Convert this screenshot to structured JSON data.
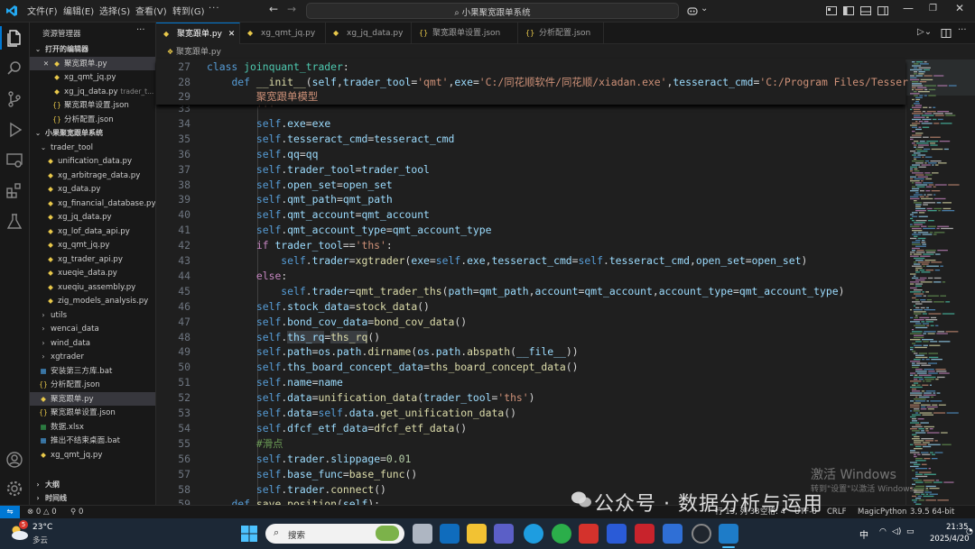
{
  "titlebar": {
    "menus": [
      "文件(F)",
      "编辑(E)",
      "选择(S)",
      "查看(V)",
      "转到(G)"
    ],
    "search_text": "小果聚宽跟单系统"
  },
  "sidebar": {
    "title": "资源管理器",
    "open_editors_header": "打开的编辑器",
    "open_editors": [
      {
        "label": "聚宽跟单.py",
        "type": "py",
        "selected": true
      },
      {
        "label": "xg_qmt_jq.py",
        "type": "py"
      },
      {
        "label": "xg_jq_data.py",
        "extra": "trader_t...",
        "type": "py"
      },
      {
        "label": "聚宽跟单设置.json",
        "type": "json"
      },
      {
        "label": "分析配置.json",
        "type": "json"
      }
    ],
    "project_header": "小果聚宽跟单系统",
    "tree": [
      {
        "label": "trader_tool",
        "type": "folder-open",
        "indent": 1
      },
      {
        "label": "unification_data.py",
        "type": "py",
        "indent": 2
      },
      {
        "label": "xg_arbitrage_data.py",
        "type": "py",
        "indent": 2
      },
      {
        "label": "xg_data.py",
        "type": "py",
        "indent": 2
      },
      {
        "label": "xg_financial_database.py",
        "type": "py",
        "indent": 2
      },
      {
        "label": "xg_jq_data.py",
        "type": "py",
        "indent": 2
      },
      {
        "label": "xg_lof_data_api.py",
        "type": "py",
        "indent": 2
      },
      {
        "label": "xg_qmt_jq.py",
        "type": "py",
        "indent": 2
      },
      {
        "label": "xg_trader_api.py",
        "type": "py",
        "indent": 2
      },
      {
        "label": "xueqie_data.py",
        "type": "py",
        "indent": 2
      },
      {
        "label": "xueqiu_assembly.py",
        "type": "py",
        "indent": 2
      },
      {
        "label": "zig_models_analysis.py",
        "type": "py",
        "indent": 2
      },
      {
        "label": "utils",
        "type": "folder",
        "indent": 1
      },
      {
        "label": "wencai_data",
        "type": "folder",
        "indent": 1
      },
      {
        "label": "wind_data",
        "type": "folder",
        "indent": 1
      },
      {
        "label": "xgtrader",
        "type": "folder",
        "indent": 1
      },
      {
        "label": "安装第三方库.bat",
        "type": "bat",
        "indent": 1
      },
      {
        "label": "分析配置.json",
        "type": "json",
        "indent": 1
      },
      {
        "label": "聚宽跟单.py",
        "type": "py",
        "indent": 1,
        "selected": true
      },
      {
        "label": "聚宽跟单设置.json",
        "type": "json",
        "indent": 1
      },
      {
        "label": "数据.xlsx",
        "type": "xlsx",
        "indent": 1
      },
      {
        "label": "推出不结束桌面.bat",
        "type": "bat",
        "indent": 1
      },
      {
        "label": "xg_qmt_jq.py",
        "type": "py",
        "indent": 1
      }
    ],
    "outline_header": "大纲",
    "timeline_header": "时间线"
  },
  "tabs": [
    {
      "label": "聚宽跟单.py",
      "type": "py",
      "active": true
    },
    {
      "label": "xg_qmt_jq.py",
      "type": "py"
    },
    {
      "label": "xg_jq_data.py",
      "type": "py"
    },
    {
      "label": "聚宽跟单设置.json",
      "type": "json"
    },
    {
      "label": "分析配置.json",
      "type": "json"
    }
  ],
  "breadcrumb": "聚宽跟单.py",
  "sticky": [
    {
      "n": "27",
      "html": "<span class=\"kw\">class</span> <span class=\"cls\">joinquant_trader</span>:"
    },
    {
      "n": "28",
      "html": "    <span class=\"kw\">def</span> <span class=\"fn\">__init__</span>(<span class=\"pm\">self</span>,<span class=\"pm\">trader_tool</span>=<span class=\"st\">'qmt'</span>,<span class=\"pm\">exe</span>=<span class=\"st\">'C:/同花顺软件/同花顺/xiadan.exe'</span>,<span class=\"pm\">tesseract_cmd</span>=<span class=\"st\">'C:/Program Files/Tesser</span>"
    },
    {
      "n": "29",
      "html": "        <span class=\"st\">聚宽跟单模型</span>"
    }
  ],
  "code": [
    {
      "n": "33",
      "html": "        <span class=\"st\">'''</span>"
    },
    {
      "n": "34",
      "html": "        <span class=\"sf\">self</span>.<span class=\"pm\">exe</span>=<span class=\"pm\">exe</span>"
    },
    {
      "n": "35",
      "html": "        <span class=\"sf\">self</span>.<span class=\"pm\">tesseract_cmd</span>=<span class=\"pm\">tesseract_cmd</span>"
    },
    {
      "n": "36",
      "html": "        <span class=\"sf\">self</span>.<span class=\"pm\">qq</span>=<span class=\"pm\">qq</span>"
    },
    {
      "n": "37",
      "html": "        <span class=\"sf\">self</span>.<span class=\"pm\">trader_tool</span>=<span class=\"pm\">trader_tool</span>"
    },
    {
      "n": "38",
      "html": "        <span class=\"sf\">self</span>.<span class=\"pm\">open_set</span>=<span class=\"pm\">open_set</span>"
    },
    {
      "n": "39",
      "html": "        <span class=\"sf\">self</span>.<span class=\"pm\">qmt_path</span>=<span class=\"pm\">qmt_path</span>"
    },
    {
      "n": "40",
      "html": "        <span class=\"sf\">self</span>.<span class=\"pm\">qmt_account</span>=<span class=\"pm\">qmt_account</span>"
    },
    {
      "n": "41",
      "html": "        <span class=\"sf\">self</span>.<span class=\"pm\">qmt_account_type</span>=<span class=\"pm\">qmt_account_type</span>"
    },
    {
      "n": "42",
      "html": "        <span class=\"ctl\">if</span> <span class=\"pm\">trader_tool</span>==<span class=\"st\">'ths'</span>:"
    },
    {
      "n": "43",
      "html": "            <span class=\"sf\">self</span>.<span class=\"pm\">trader</span>=<span class=\"fn\">xgtrader</span>(<span class=\"pm\">exe</span>=<span class=\"sf\">self</span>.<span class=\"pm\">exe</span>,<span class=\"pm\">tesseract_cmd</span>=<span class=\"sf\">self</span>.<span class=\"pm\">tesseract_cmd</span>,<span class=\"pm\">open_set</span>=<span class=\"pm\">open_set</span>)"
    },
    {
      "n": "44",
      "html": "        <span class=\"ctl\">else</span>:"
    },
    {
      "n": "45",
      "html": "            <span class=\"sf\">self</span>.<span class=\"pm\">trader</span>=<span class=\"fn\">qmt_trader_ths</span>(<span class=\"pm\">path</span>=<span class=\"pm\">qmt_path</span>,<span class=\"pm\">account</span>=<span class=\"pm\">qmt_account</span>,<span class=\"pm\">account_type</span>=<span class=\"pm\">qmt_account_type</span>)"
    },
    {
      "n": "46",
      "html": "        <span class=\"sf\">self</span>.<span class=\"pm\">stock_data</span>=<span class=\"fn\">stock_data</span>()"
    },
    {
      "n": "47",
      "html": "        <span class=\"sf\">self</span>.<span class=\"pm\">bond_cov_data</span>=<span class=\"fn\">bond_cov_data</span>()"
    },
    {
      "n": "48",
      "html": "        <span class=\"sf\">self</span>.<span class=\"pm hl\">ths_rq</span>=<span class=\"fn hl\">ths_rq</span>()"
    },
    {
      "n": "49",
      "html": "        <span class=\"sf\">self</span>.<span class=\"pm\">path</span>=<span class=\"pm\">os</span>.<span class=\"pm\">path</span>.<span class=\"fn\">dirname</span>(<span class=\"pm\">os</span>.<span class=\"pm\">path</span>.<span class=\"fn\">abspath</span>(<span class=\"pm\">__file__</span>))"
    },
    {
      "n": "50",
      "html": "        <span class=\"sf\">self</span>.<span class=\"pm\">ths_board_concept_data</span>=<span class=\"fn\">ths_board_concept_data</span>()"
    },
    {
      "n": "51",
      "html": "        <span class=\"sf\">self</span>.<span class=\"pm\">name</span>=<span class=\"pm\">name</span>"
    },
    {
      "n": "52",
      "html": "        <span class=\"sf\">self</span>.<span class=\"pm\">data</span>=<span class=\"fn\">unification_data</span>(<span class=\"pm\">trader_tool</span>=<span class=\"st\">'ths'</span>)"
    },
    {
      "n": "53",
      "html": "        <span class=\"sf\">self</span>.<span class=\"pm\">data</span>=<span class=\"sf\">self</span>.<span class=\"pm\">data</span>.<span class=\"fn\">get_unification_data</span>()"
    },
    {
      "n": "54",
      "html": "        <span class=\"sf\">self</span>.<span class=\"pm\">dfcf_etf_data</span>=<span class=\"fn\">dfcf_etf_data</span>()"
    },
    {
      "n": "55",
      "html": "        <span class=\"cm\">#滑点</span>"
    },
    {
      "n": "56",
      "html": "        <span class=\"sf\">self</span>.<span class=\"pm\">trader</span>.<span class=\"pm\">slippage</span>=<span class=\"nm\">0.01</span>"
    },
    {
      "n": "57",
      "html": "        <span class=\"sf\">self</span>.<span class=\"pm\">base_func</span>=<span class=\"fn\">base_func</span>()"
    },
    {
      "n": "58",
      "html": "        <span class=\"sf\">self</span>.<span class=\"pm\">trader</span>.<span class=\"fn\">connect</span>()"
    },
    {
      "n": "59",
      "html": "    <span class=\"kw\">def</span> <span class=\"fn\">save_position</span>(<span class=\"pm\">self</span>):"
    }
  ],
  "statusbar": {
    "errors": "0",
    "warnings": "0",
    "ports": "0",
    "position": "行 13, 列 38",
    "spaces": "空格: 4",
    "encoding": "UTF-8",
    "eol": "CRLF",
    "language": "MagicPython",
    "interpreter": "3.9.5 64-bit"
  },
  "taskbar": {
    "weather_temp": "23°C",
    "weather_desc": "多云",
    "weather_badge": "5",
    "search_placeholder": "搜索",
    "ime": "中",
    "time": "21:35",
    "date": "2025/4/20"
  },
  "overlay": {
    "activate_title": "激活 Windows",
    "activate_sub": "转到\"设置\"以激活 Windows。",
    "watermark": "公众号 · 数据分析与运用"
  },
  "colors": {
    "accent": "#0078d4",
    "editor_bg": "#1f1f1f",
    "sidebar_bg": "#181818"
  }
}
